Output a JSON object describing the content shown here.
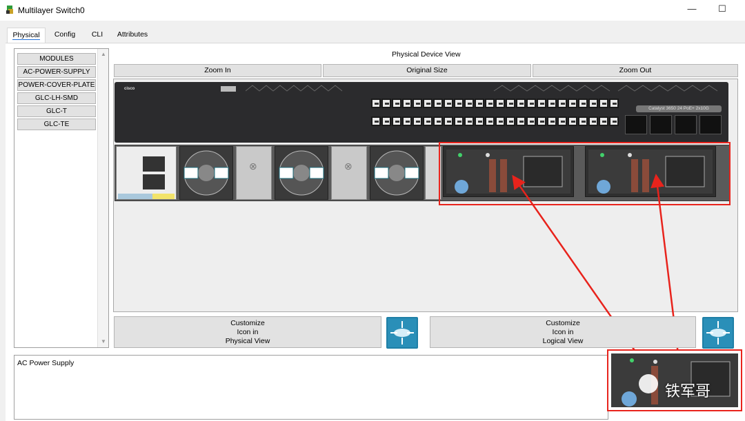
{
  "window": {
    "title": "Multilayer Switch0",
    "minimize_glyph": "—",
    "maximize_glyph": "☐"
  },
  "tabs": [
    {
      "label": "Physical",
      "active": true
    },
    {
      "label": "Config",
      "active": false
    },
    {
      "label": "CLI",
      "active": false
    },
    {
      "label": "Attributes",
      "active": false
    }
  ],
  "modules": {
    "items": [
      "MODULES",
      "AC-POWER-SUPPLY",
      "POWER-COVER-PLATE",
      "GLC-LH-SMD",
      "GLC-T",
      "GLC-TE"
    ]
  },
  "physical_view": {
    "title": "Physical Device View",
    "zoom_in": "Zoom In",
    "original_size": "Original Size",
    "zoom_out": "Zoom Out",
    "model_label": "Catalyst 3650 24 PoE+ 2x10G",
    "vendor_logo": "cisco"
  },
  "customize": {
    "physical": [
      "Customize",
      "Icon in",
      "Physical View"
    ],
    "logical": [
      "Customize",
      "Icon in",
      "Logical View"
    ]
  },
  "description": {
    "text": "AC Power Supply"
  },
  "watermark": {
    "text": "铁军哥"
  },
  "colors": {
    "highlight": "#e8231c",
    "switch_icon": "#1f7fa6"
  }
}
